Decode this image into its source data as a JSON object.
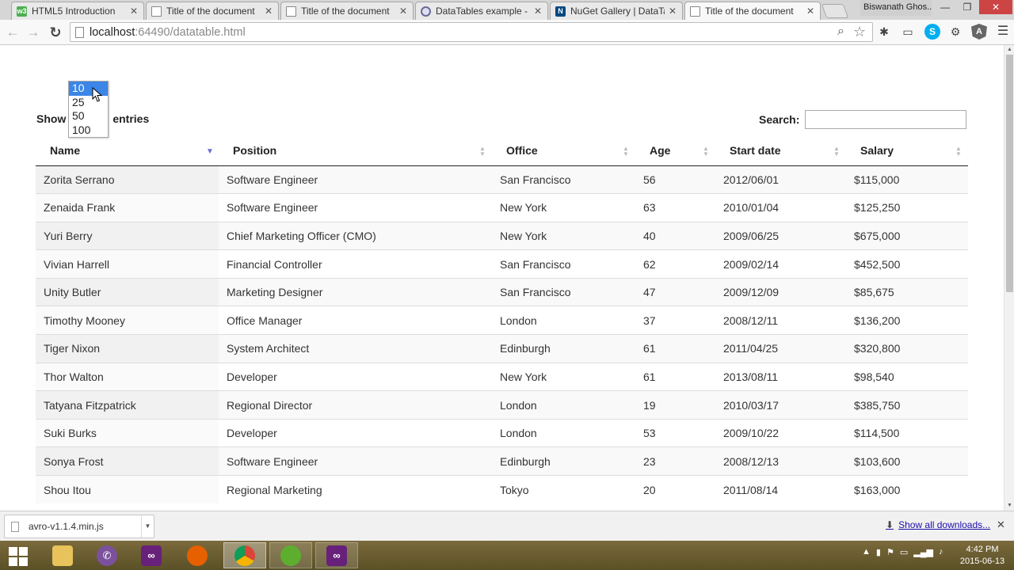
{
  "browser": {
    "tabs": [
      {
        "title": "HTML5 Introduction",
        "favicon": "w3schools-icon"
      },
      {
        "title": "Title of the document",
        "favicon": "document-icon"
      },
      {
        "title": "Title of the document",
        "favicon": "document-icon"
      },
      {
        "title": "DataTables example - Ze",
        "favicon": "datatables-icon"
      },
      {
        "title": "NuGet Gallery | DataTab",
        "favicon": "nuget-icon"
      },
      {
        "title": "Title of the document",
        "favicon": "document-icon"
      }
    ],
    "active_tab": 5,
    "user_name": "Biswanath Ghos...",
    "url_host": "localhost",
    "url_rest": ":64490/datatable.html"
  },
  "page": {
    "length": {
      "show_label": "Show",
      "entries_label": "entries",
      "selected": "25",
      "options": [
        "10",
        "25",
        "50",
        "100"
      ],
      "highlighted": "10"
    },
    "search": {
      "label": "Search:",
      "value": ""
    },
    "table": {
      "columns": [
        "Name",
        "Position",
        "Office",
        "Age",
        "Start date",
        "Salary"
      ],
      "rows": [
        [
          "Zorita Serrano",
          "Software Engineer",
          "San Francisco",
          "56",
          "2012/06/01",
          "$115,000"
        ],
        [
          "Zenaida Frank",
          "Software Engineer",
          "New York",
          "63",
          "2010/01/04",
          "$125,250"
        ],
        [
          "Yuri Berry",
          "Chief Marketing Officer (CMO)",
          "New York",
          "40",
          "2009/06/25",
          "$675,000"
        ],
        [
          "Vivian Harrell",
          "Financial Controller",
          "San Francisco",
          "62",
          "2009/02/14",
          "$452,500"
        ],
        [
          "Unity Butler",
          "Marketing Designer",
          "San Francisco",
          "47",
          "2009/12/09",
          "$85,675"
        ],
        [
          "Timothy Mooney",
          "Office Manager",
          "London",
          "37",
          "2008/12/11",
          "$136,200"
        ],
        [
          "Tiger Nixon",
          "System Architect",
          "Edinburgh",
          "61",
          "2011/04/25",
          "$320,800"
        ],
        [
          "Thor Walton",
          "Developer",
          "New York",
          "61",
          "2013/08/11",
          "$98,540"
        ],
        [
          "Tatyana Fitzpatrick",
          "Regional Director",
          "London",
          "19",
          "2010/03/17",
          "$385,750"
        ],
        [
          "Suki Burks",
          "Developer",
          "London",
          "53",
          "2009/10/22",
          "$114,500"
        ],
        [
          "Sonya Frost",
          "Software Engineer",
          "Edinburgh",
          "23",
          "2008/12/13",
          "$103,600"
        ],
        [
          "Shou Itou",
          "Regional Marketing",
          "Tokyo",
          "20",
          "2011/08/14",
          "$163,000"
        ]
      ]
    }
  },
  "downloads": {
    "file_name": "avro-v1.1.4.min.js",
    "show_all_label": "Show all downloads..."
  },
  "taskbar": {
    "apps": [
      "file-explorer-icon",
      "viber-icon",
      "visual-studio-express-icon",
      "firefox-icon",
      "chrome-icon",
      "camtasia-icon",
      "visual-studio-icon"
    ],
    "time": "4:42 PM",
    "date": "2015-06-13"
  },
  "colors": {
    "accent": "#3b86e6",
    "sort_active": "#6b6bd8",
    "link": "#1a0dab"
  }
}
